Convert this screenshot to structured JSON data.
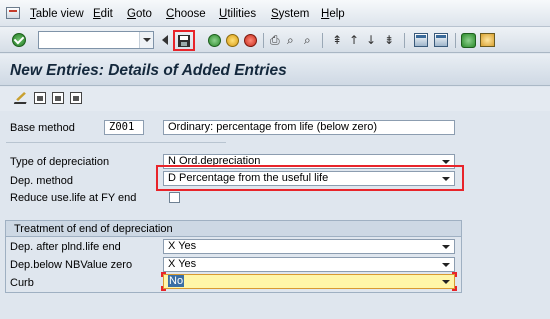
{
  "menubar": {
    "items": [
      "Table view",
      "Edit",
      "Goto",
      "Choose",
      "Utilities",
      "System",
      "Help"
    ]
  },
  "toolbar": {
    "command_value": "",
    "icons": [
      "enter-icon",
      "command-field",
      "back-icon",
      "save-icon",
      "back-green-icon",
      "exit-icon",
      "cancel-icon",
      "print-icon",
      "find-icon",
      "find-next-icon",
      "first-page-icon",
      "prev-page-icon",
      "next-page-icon",
      "last-page-icon",
      "create-session-icon",
      "shortcut-icon",
      "help-icon"
    ]
  },
  "page": {
    "title": "New Entries: Details of Added Entries"
  },
  "form": {
    "base_method": {
      "label": "Base method",
      "code": "Z001",
      "description": "Ordinary: percentage from life (below zero)"
    },
    "type_of_depreciation": {
      "label": "Type of depreciation",
      "value": "N Ord.depreciation"
    },
    "dep_method": {
      "label": "Dep. method",
      "value": "D Percentage from the useful life"
    },
    "reduce_use_life": {
      "label": "Reduce use.life at FY end",
      "checked": false
    }
  },
  "group": {
    "title": "Treatment of end of depreciation",
    "rows": [
      {
        "label": "Dep. after plnd.life end",
        "value": "X Yes"
      },
      {
        "label": "Dep.below NBValue zero",
        "value": "X Yes"
      },
      {
        "label": "Curb",
        "value": "No"
      }
    ]
  },
  "colors": {
    "highlight": "#e8242a",
    "focus_field": "#fff6a8"
  }
}
